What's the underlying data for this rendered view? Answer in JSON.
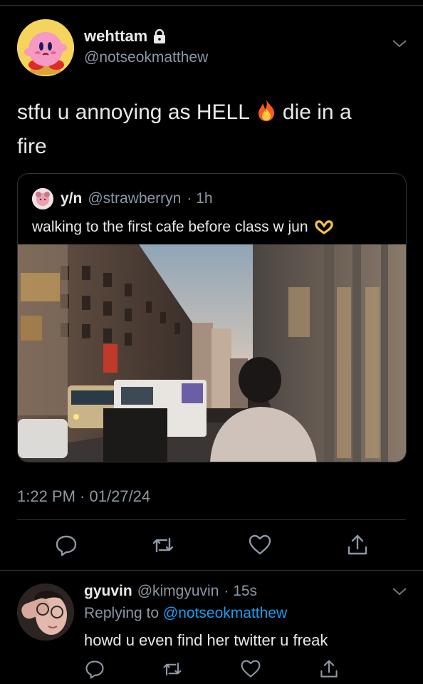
{
  "tweet": {
    "display_name": "wehttam",
    "handle": "@notseokmatthew",
    "text_part1": "stfu u annoying as HELL",
    "text_part2": "die in a",
    "text_part3": "fire",
    "emoji": "fire-emoji",
    "timestamp": "1:22 PM · 01/27/24"
  },
  "quote": {
    "display_name": "y/n",
    "handle": "@strawberryn",
    "time": "· 1h",
    "text": "walking to the first cafe before class w jun",
    "emoji": "heart-hands-emoji"
  },
  "reply": {
    "display_name": "gyuvin",
    "handle": "@kimgyuvin",
    "time": "· 15s",
    "replying_prefix": "Replying to",
    "replying_to": "@notseokmatthew",
    "text": "howd u even find her twitter u freak"
  },
  "icons": {
    "reply": "reply-icon",
    "retweet": "retweet-icon",
    "like": "like-icon",
    "share": "share-icon",
    "lock": "lock-icon",
    "chevron": "chevron-down-icon"
  },
  "colors": {
    "background": "#000000",
    "text": "#e7e9ea",
    "secondary": "#8b98a5",
    "link": "#1d9bf0",
    "border": "#2f3336"
  }
}
